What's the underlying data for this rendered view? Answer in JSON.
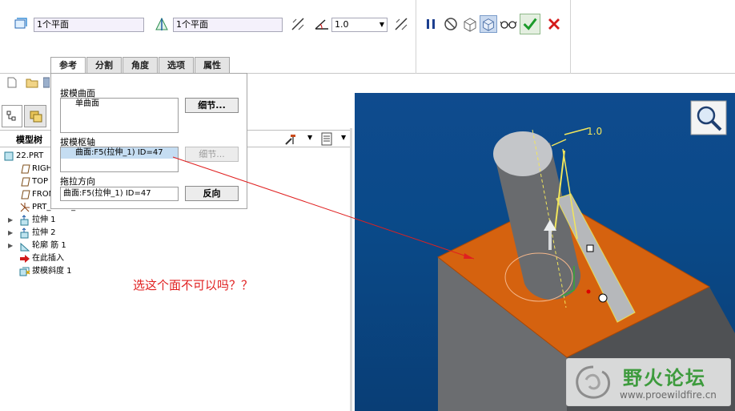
{
  "dashboard": {
    "ref_collector_1": "1个平面",
    "ref_collector_2": "1个平面",
    "angle_value": "1.0"
  },
  "panel": {
    "tabs": [
      "参考",
      "分割",
      "角度",
      "选项",
      "属性"
    ],
    "draft_surfaces_label": "拔模曲面",
    "draft_surfaces_items": [
      "单曲面"
    ],
    "hinges_label": "拔模枢轴",
    "hinges_items": [
      "曲面:F5(拉伸_1) ID=47"
    ],
    "pull_direction_label": "拖拉方向",
    "pull_direction_value": "曲面:F5(拉伸_1) ID=47",
    "details_button": "细节...",
    "details_button_2": "细节...",
    "flip_button": "反向"
  },
  "navigator": {
    "title": "模型树",
    "items": [
      {
        "label": "22.PRT",
        "icon": "part-icon"
      },
      {
        "label": "RIGHT",
        "icon": "datum-plane-icon"
      },
      {
        "label": "TOP",
        "icon": "datum-plane-icon"
      },
      {
        "label": "FRONT",
        "icon": "datum-plane-icon"
      },
      {
        "label": "PRT_CSYS_DEF",
        "icon": "csys-icon"
      },
      {
        "label": "拉伸 1",
        "icon": "extrude-icon"
      },
      {
        "label": "拉伸 2",
        "icon": "extrude-icon"
      },
      {
        "label": "轮廓 筋 1",
        "icon": "rib-icon"
      },
      {
        "label": "在此插入",
        "icon": "insert-arrow-icon"
      },
      {
        "label": "拔模斜度 1",
        "icon": "draft-icon"
      }
    ]
  },
  "viewport": {
    "angle_label": "1.0"
  },
  "annotation": {
    "text": "选这个面不可以吗？？"
  },
  "watermark": {
    "title": "野火论坛",
    "url": "www.proewildfire.cn"
  },
  "colors": {
    "orange_face": "#d5620f",
    "gray_body": "#5b5d60",
    "viewport_bg": "#0c4a8a",
    "annotation": "#e02020"
  }
}
